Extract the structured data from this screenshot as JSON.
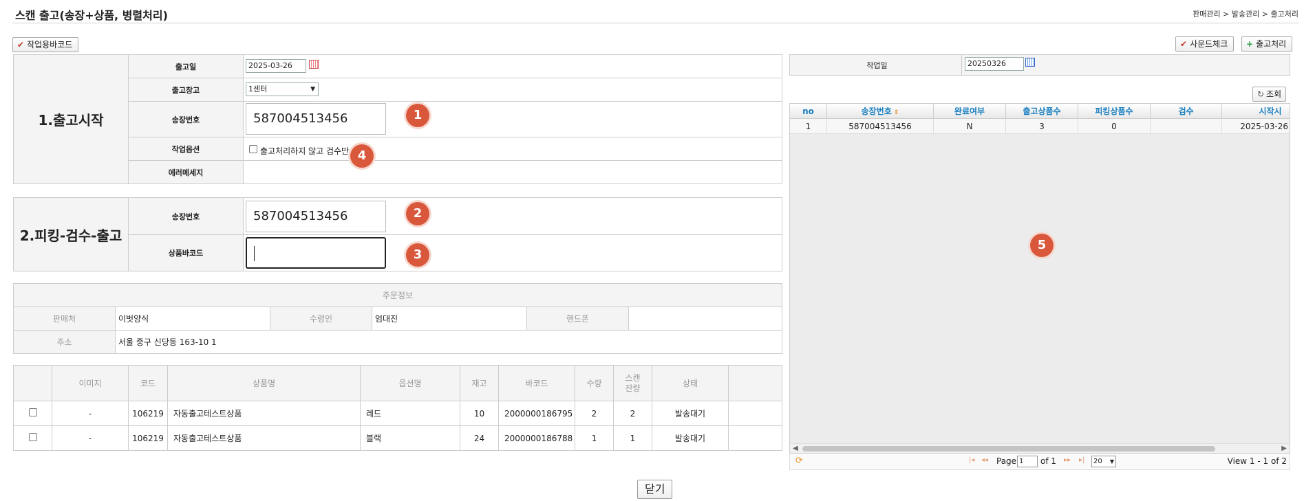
{
  "header": {
    "title": "스캔 출고(송장+상품, 병렬처리)",
    "breadcrumb": "판매관리 > 발송관리 > 출고처리"
  },
  "toolbar": {
    "work_barcode": "작업용바코드",
    "sound_check": "사운드체크",
    "ship_process": "출고처리"
  },
  "section1": {
    "title": "1.출고시작",
    "ship_date_label": "출고일",
    "ship_date_value": "2025-03-26",
    "warehouse_label": "출고창고",
    "warehouse_value": "1센터",
    "invoice_label": "송장번호",
    "invoice_value": "587004513456",
    "option_label": "작업옵션",
    "option_text": "출고처리하지 않고 검수만",
    "error_label": "에러메세지",
    "error_value": ""
  },
  "section2": {
    "title": "2.피킹-검수-출고",
    "invoice_label": "송장번호",
    "invoice_value": "587004513456",
    "barcode_label": "상품바코드",
    "barcode_value": ""
  },
  "badges": [
    "1",
    "2",
    "3",
    "4",
    "5"
  ],
  "order_info": {
    "title": "주문정보",
    "seller_label": "판매처",
    "seller_value": "이벗양식",
    "receiver_label": "수령인",
    "receiver_value": "엄대진",
    "phone_label": "핸드폰",
    "phone_value": "",
    "address_label": "주소",
    "address_value": "서울 중구 신당동 163-10 1"
  },
  "items_table": {
    "headers": [
      "이미지",
      "코드",
      "상품명",
      "옵션명",
      "재고",
      "바코드",
      "수량",
      "스캔\n잔량",
      "상태"
    ],
    "rows": [
      {
        "image": "-",
        "code": "106219",
        "name": "자동출고테스트상품",
        "option": "레드",
        "stock": "10",
        "barcode": "2000000186795",
        "qty": "2",
        "remain": "2",
        "status": "발송대기"
      },
      {
        "image": "-",
        "code": "106219",
        "name": "자동출고테스트상품",
        "option": "블랙",
        "stock": "24",
        "barcode": "2000000186788",
        "qty": "1",
        "remain": "1",
        "status": "발송대기"
      }
    ]
  },
  "right_panel": {
    "work_date_label": "작업일",
    "work_date_value": "20250326",
    "search_button": "조회",
    "grid_headers": [
      "no",
      "송장번호",
      "완료여부",
      "출고상품수",
      "피킹상품수",
      "검수",
      "시작시"
    ],
    "grid_row": {
      "no": "1",
      "invoice": "587004513456",
      "done": "N",
      "ship_qty": "3",
      "pick_qty": "0",
      "check": "",
      "start": "2025-03-26"
    },
    "pager": {
      "page_label": "Page",
      "page_value": "1",
      "of_label": "of 1",
      "page_size": "20",
      "view_text": "View 1 - 1 of 2"
    }
  },
  "close_button": "닫기",
  "colors": {
    "badge": "#d9573b",
    "grid_header_text": "#1a7fc1"
  }
}
